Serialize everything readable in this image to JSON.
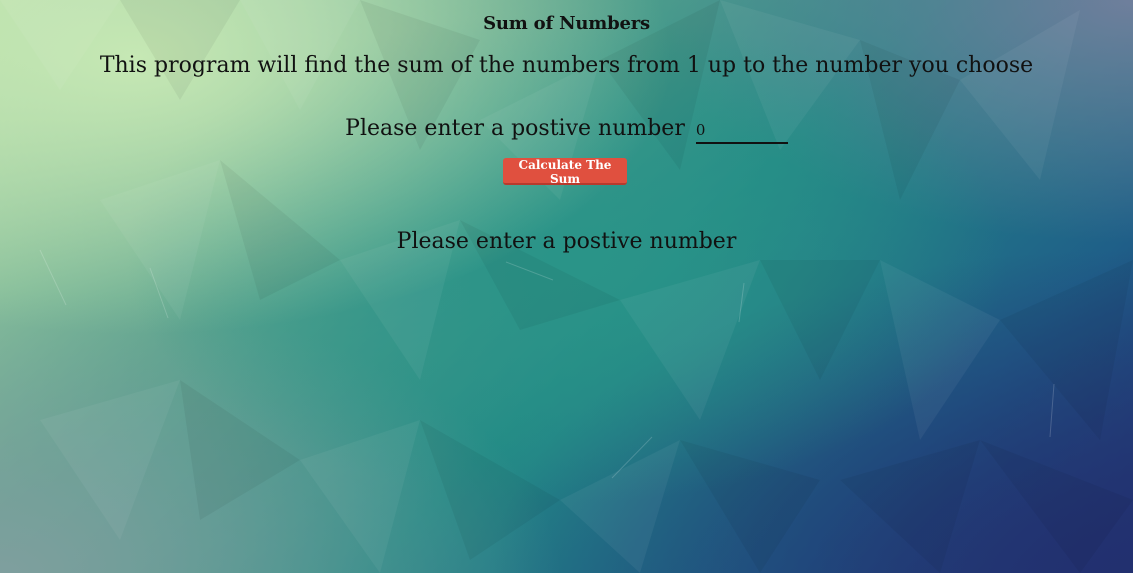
{
  "page": {
    "title": "Sum of Numbers",
    "description": "This program will find the sum of the numbers from 1 up to the number you choose"
  },
  "form": {
    "prompt_label": "Please enter a postive number",
    "input_value": "0",
    "button_label": "Calculate The Sum"
  },
  "result": {
    "message": "Please enter a postive number"
  },
  "colors": {
    "button_bg": "#e0503f",
    "text": "#111111"
  }
}
